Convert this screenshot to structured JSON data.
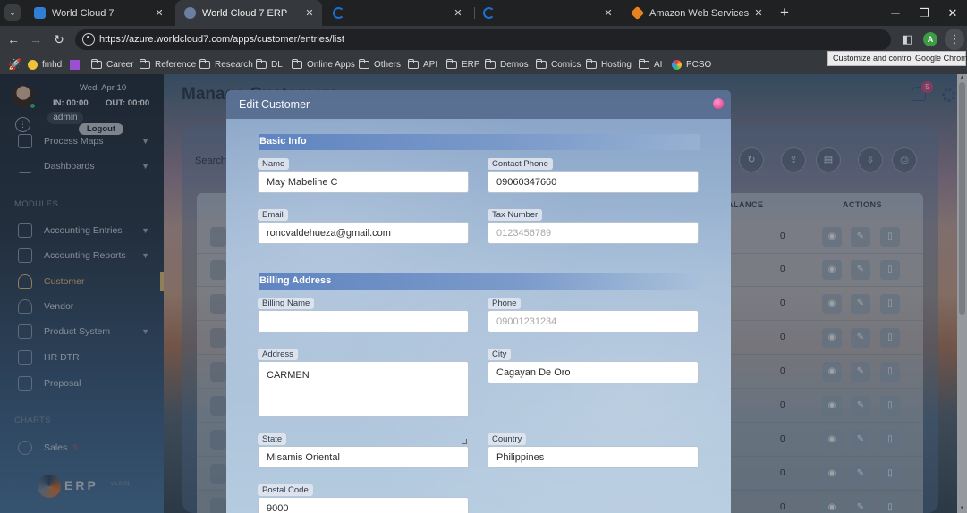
{
  "browser": {
    "tabs": [
      {
        "title": "World Cloud 7",
        "favicon_color": "#2f7fd6"
      },
      {
        "title": "World Cloud 7 ERP",
        "favicon_color": "#6b7fa3"
      },
      {
        "title": "",
        "favicon_color": "#1d6fd1"
      },
      {
        "title": "",
        "favicon_color": "#1d6fd1"
      },
      {
        "title": "Amazon Web Services Sign-In",
        "favicon_color": "#e8821e"
      }
    ],
    "url": "https://azure.worldcloud7.com/apps/customer/entries/list",
    "profile_initial": "A",
    "tooltip": "Customize and control Google Chrome",
    "bookmarks": [
      "fmhd",
      "Career",
      "Reference",
      "Research",
      "DL",
      "Online Apps",
      "Others",
      "API",
      "ERP",
      "Demos",
      "Comics",
      "Hosting",
      "AI",
      "PCSO"
    ]
  },
  "sidebar": {
    "date": "Wed, Apr 10",
    "in_time": "IN: 00:00",
    "out_time": "OUT: 00:00",
    "username": "admin",
    "logout": "Logout",
    "top_items": [
      {
        "label": "Process Maps"
      },
      {
        "label": "Dashboards"
      }
    ],
    "modules_label": "MODULES",
    "modules": [
      {
        "label": "Accounting Entries"
      },
      {
        "label": "Accounting Reports"
      },
      {
        "label": "Customer"
      },
      {
        "label": "Vendor"
      },
      {
        "label": "Product System"
      },
      {
        "label": "HR DTR"
      },
      {
        "label": "Proposal"
      }
    ],
    "charts_label": "CHARTS",
    "charts": [
      {
        "label": "Sales",
        "badge": "3"
      }
    ],
    "brand": "ERP",
    "version": "v1.0.01"
  },
  "main": {
    "title": "Manage Customers",
    "notification_count": "5",
    "search_label": "Search",
    "columns": {
      "balance": "BALANCE",
      "actions": "ACTIONS"
    },
    "row_value": "0"
  },
  "modal": {
    "title": "Edit Customer",
    "basic_info": {
      "title": "Basic Info",
      "name": {
        "label": "Name",
        "value": "May Mabeline C"
      },
      "contact_phone": {
        "label": "Contact Phone",
        "value": "09060347660"
      },
      "email": {
        "label": "Email",
        "value": "roncvaldehueza@gmail.com"
      },
      "tax_number": {
        "label": "Tax Number",
        "placeholder": "0123456789"
      }
    },
    "billing": {
      "title": "Billing Address",
      "billing_name": {
        "label": "Billing Name",
        "value": ""
      },
      "phone": {
        "label": "Phone",
        "placeholder": "09001231234"
      },
      "address": {
        "label": "Address",
        "value": "CARMEN"
      },
      "city": {
        "label": "City",
        "value": "Cagayan De Oro"
      },
      "state": {
        "label": "State",
        "value": "Misamis Oriental"
      },
      "country": {
        "label": "Country",
        "value": "Philippines"
      },
      "postal_code": {
        "label": "Postal Code",
        "value": "9000"
      }
    }
  }
}
